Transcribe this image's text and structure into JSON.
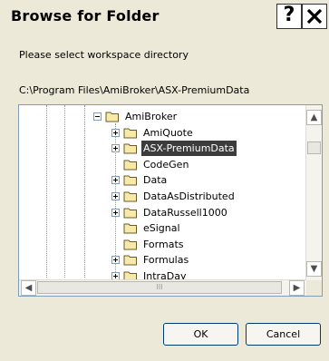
{
  "window": {
    "title": "Browse for Folder",
    "help_glyph": "?",
    "close_glyph": "X"
  },
  "dialog": {
    "prompt": "Please select workspace directory",
    "current_path": "C:\\Program Files\\AmiBroker\\ASX-PremiumData"
  },
  "tree": {
    "items": [
      {
        "label": "AmiBroker",
        "level": 0,
        "expander": "minus",
        "selected": false
      },
      {
        "label": "AmiQuote",
        "level": 1,
        "expander": "plus",
        "selected": false
      },
      {
        "label": "ASX-PremiumData",
        "level": 1,
        "expander": "plus",
        "selected": true
      },
      {
        "label": "CodeGen",
        "level": 1,
        "expander": "none",
        "selected": false
      },
      {
        "label": "Data",
        "level": 1,
        "expander": "plus",
        "selected": false
      },
      {
        "label": "DataAsDistributed",
        "level": 1,
        "expander": "plus",
        "selected": false
      },
      {
        "label": "DataRussell1000",
        "level": 1,
        "expander": "plus",
        "selected": false
      },
      {
        "label": "eSignal",
        "level": 1,
        "expander": "none",
        "selected": false
      },
      {
        "label": "Formats",
        "level": 1,
        "expander": "none",
        "selected": false
      },
      {
        "label": "Formulas",
        "level": 1,
        "expander": "plus",
        "selected": false
      },
      {
        "label": "IntraDay",
        "level": 1,
        "expander": "plus",
        "selected": false
      }
    ],
    "selected_color": "#3c3c3c",
    "folder_color": "#f7e9a8"
  },
  "scroll": {
    "up_glyph": "▲",
    "down_glyph": "▼",
    "left_glyph": "◀",
    "right_glyph": "▶",
    "grip_glyph": "III"
  },
  "buttons": {
    "ok_label": "OK",
    "cancel_label": "Cancel"
  }
}
